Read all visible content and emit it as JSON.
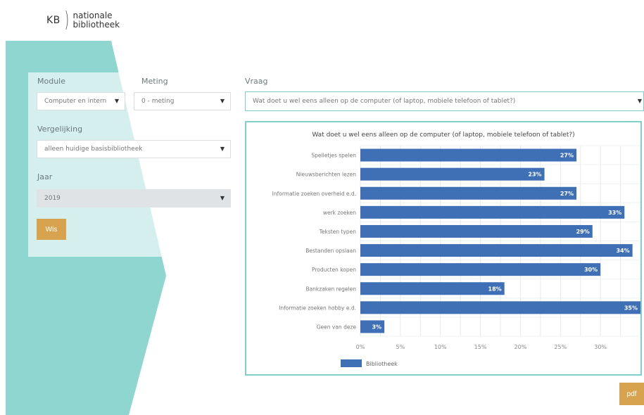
{
  "logo": {
    "kb": "KB",
    "line1": "nationale",
    "line2": "bibliotheek"
  },
  "colors": {
    "teal": "#8fd5d0",
    "bar": "#3f6fb5",
    "button": "#d8a34f",
    "border": "#7fcfcb"
  },
  "filters": {
    "module": {
      "label": "Module",
      "value": "Computer en intern"
    },
    "meting": {
      "label": "Meting",
      "value": "0 - meting"
    },
    "vraag": {
      "label": "Vraag",
      "value": "Wat doet u wel eens alleen op de computer (of laptop, mobiele telefoon of tablet?)"
    },
    "vergelijking": {
      "label": "Vergelijking",
      "value": "alleen huidige basisbibliotheek"
    },
    "jaar": {
      "label": "Jaar",
      "value": "2019"
    },
    "wis_label": "Wis"
  },
  "pdf_label": "pdf",
  "chart_data": {
    "type": "bar",
    "orientation": "horizontal",
    "title": "Wat doet u wel eens alleen op de computer (of laptop, mobiele telefoon of tablet?)",
    "categories": [
      "Spelletjes spelen",
      "Nieuwsberichten lezen",
      "Informatie zoeken overheid e.d.",
      "werk zoeken",
      "Teksten typen",
      "Bestanden opslaan",
      "Producten kopen",
      "Bankzaken regelen",
      "Informatie zoeken hobby e.d.",
      "Geen van deze"
    ],
    "series": [
      {
        "name": "Bibliotheek",
        "values": [
          27,
          23,
          27,
          33,
          29,
          34,
          30,
          18,
          35,
          3
        ]
      }
    ],
    "value_labels": [
      "27%",
      "23%",
      "27%",
      "33%",
      "29%",
      "34%",
      "30%",
      "18%",
      "35%",
      "3%"
    ],
    "x_ticks": [
      "0%",
      "5%",
      "10%",
      "15%",
      "20%",
      "25%",
      "30%"
    ],
    "xlim": [
      0,
      35
    ],
    "grid": true,
    "legend_position": "bottom-left"
  }
}
